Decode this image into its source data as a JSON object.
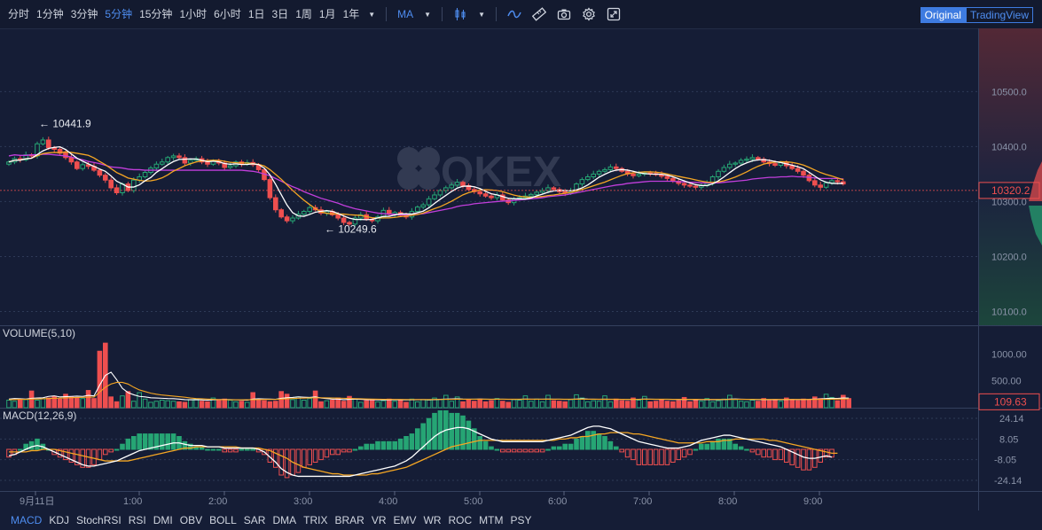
{
  "toolbar": {
    "timeframes": [
      {
        "label": "分时",
        "active": false
      },
      {
        "label": "1分钟",
        "active": false
      },
      {
        "label": "3分钟",
        "active": false
      },
      {
        "label": "5分钟",
        "active": true
      },
      {
        "label": "15分钟",
        "active": false
      },
      {
        "label": "1小时",
        "active": false
      },
      {
        "label": "6小时",
        "active": false
      },
      {
        "label": "1日",
        "active": false
      },
      {
        "label": "3日",
        "active": false
      },
      {
        "label": "1周",
        "active": false
      },
      {
        "label": "1月",
        "active": false
      },
      {
        "label": "1年",
        "active": false
      }
    ],
    "indicator_label": "MA",
    "view_original": "Original",
    "view_tradingview": "TradingView",
    "icons": [
      "candle-type-icon",
      "line-style-icon",
      "ruler-icon",
      "camera-icon",
      "gear-icon",
      "fullscreen-icon"
    ]
  },
  "watermark": "OKEX",
  "colors": {
    "up": "#26a574",
    "down": "#ee4f4f",
    "ma5": "#ffffff",
    "ma10": "#f5a623",
    "ma30": "#c13edb",
    "accent": "#4e8df0"
  },
  "chart_data": [
    {
      "type": "candlestick",
      "panel": "price",
      "y_ticks": [
        10100.0,
        10200.0,
        10300.0,
        10400.0,
        10500.0
      ],
      "ylim": [
        10075,
        10615
      ],
      "x_ticks": [
        "9月11日",
        "1:00",
        "2:00",
        "3:00",
        "4:00",
        "5:00",
        "6:00",
        "7:00",
        "8:00",
        "9:00"
      ],
      "last_price": "10320.2",
      "high_label": "10441.9",
      "low_label": "10249.6",
      "series_keys": [
        "MA5",
        "MA10",
        "MA30"
      ],
      "close": [
        10372,
        10378,
        10376,
        10385,
        10383,
        10405,
        10412,
        10398,
        10395,
        10388,
        10380,
        10372,
        10360,
        10367,
        10364,
        10357,
        10348,
        10339,
        10325,
        10316,
        10332,
        10320,
        10339,
        10345,
        10353,
        10361,
        10368,
        10372,
        10380,
        10383,
        10380,
        10370,
        10375,
        10378,
        10372,
        10368,
        10374,
        10370,
        10362,
        10365,
        10372,
        10368,
        10371,
        10367,
        10358,
        10340,
        10307,
        10285,
        10272,
        10265,
        10270,
        10277,
        10282,
        10289,
        10285,
        10279,
        10282,
        10276,
        10270,
        10262,
        10259,
        10270,
        10276,
        10268,
        10265,
        10272,
        10284,
        10277,
        10280,
        10275,
        10272,
        10282,
        10290,
        10294,
        10305,
        10312,
        10320,
        10325,
        10330,
        10335,
        10329,
        10322,
        10318,
        10314,
        10310,
        10307,
        10312,
        10303,
        10298,
        10305,
        10307,
        10310,
        10313,
        10317,
        10320,
        10325,
        10322,
        10318,
        10315,
        10319,
        10332,
        10340,
        10345,
        10350,
        10355,
        10358,
        10363,
        10360,
        10355,
        10350,
        10347,
        10350,
        10352,
        10351,
        10349,
        10346,
        10342,
        10337,
        10333,
        10330,
        10328,
        10326,
        10329,
        10333,
        10345,
        10355,
        10362,
        10368,
        10370,
        10375,
        10377,
        10380,
        10377,
        10372,
        10369,
        10366,
        10371,
        10365,
        10360,
        10355,
        10348,
        10338,
        10330,
        10326,
        10334,
        10338,
        10336,
        10332
      ],
      "ma30": [
        10383,
        10385,
        10384,
        10384,
        10385,
        10385,
        10386,
        10386,
        10385,
        10384,
        10383,
        10381,
        10378,
        10376,
        10373,
        10371,
        10369,
        10366,
        10363,
        10362,
        10361,
        10359,
        10358,
        10358,
        10357,
        10357,
        10357,
        10357,
        10357,
        10357,
        10357,
        10357,
        10357,
        10357,
        10357,
        10357,
        10357,
        10357,
        10357,
        10357,
        10357,
        10357,
        10356,
        10355,
        10353,
        10350,
        10347,
        10342,
        10337,
        10332,
        10327,
        10323,
        10318,
        10314,
        10310,
        10306,
        10303,
        10300,
        10297,
        10293,
        10290,
        10287,
        10285,
        10283,
        10281,
        10279,
        10278,
        10277,
        10277,
        10276,
        10276,
        10276,
        10277,
        10278,
        10280,
        10282,
        10284,
        10286,
        10288,
        10291,
        10293,
        10294,
        10296,
        10297,
        10298,
        10299,
        10300,
        10301,
        10301,
        10302,
        10303,
        10304,
        10305,
        10306,
        10307,
        10309,
        10310,
        10311,
        10312,
        10314,
        10316,
        10318,
        10320,
        10322,
        10324,
        10326,
        10328,
        10330,
        10331,
        10333,
        10334,
        10335,
        10336,
        10337,
        10337,
        10337,
        10337,
        10337,
        10336,
        10336,
        10335,
        10335,
        10334,
        10334,
        10334,
        10334,
        10335,
        10336,
        10337,
        10338,
        10339,
        10341,
        10342,
        10343,
        10344,
        10344,
        10345,
        10345,
        10346,
        10345,
        10345,
        10344,
        10343,
        10342,
        10342,
        10342,
        10342,
        10341
      ],
      "volume": [
        140,
        120,
        160,
        150,
        310,
        140,
        170,
        180,
        210,
        160,
        250,
        200,
        180,
        170,
        320,
        170,
        1050,
        1200,
        200,
        110,
        220,
        300,
        120,
        280,
        160,
        100,
        120,
        140,
        130,
        120,
        110,
        100,
        150,
        160,
        120,
        110,
        180,
        150,
        160,
        140,
        110,
        120,
        100,
        280,
        150,
        130,
        110,
        120,
        300,
        250,
        150,
        200,
        140,
        170,
        310,
        110,
        130,
        140,
        180,
        120,
        210,
        160,
        100,
        130,
        150,
        110,
        130,
        160,
        120,
        140,
        100,
        160,
        110,
        150,
        140,
        180,
        150,
        230,
        120,
        200,
        110,
        140,
        120,
        160,
        110,
        130,
        170,
        120,
        100,
        150,
        140,
        220,
        120,
        160,
        110,
        230,
        130,
        120,
        110,
        150,
        240,
        180,
        110,
        130,
        120,
        220,
        110,
        160,
        130,
        120,
        180,
        140,
        210,
        110,
        120,
        150,
        120,
        110,
        130,
        190,
        110,
        150,
        120,
        170,
        110,
        130,
        160,
        230,
        150,
        120,
        110,
        140,
        120,
        170,
        130,
        150,
        120,
        180,
        140,
        130,
        160,
        150,
        200,
        170,
        250,
        190,
        130,
        230,
        170
      ],
      "volume_vma5": [
        160,
        170,
        165,
        160,
        175,
        180,
        185,
        210,
        220,
        200,
        205,
        210,
        215,
        210,
        230,
        220,
        420,
        600,
        660,
        520,
        360,
        280,
        240,
        210,
        200,
        185,
        180,
        175,
        170,
        168,
        160,
        150,
        148,
        150,
        145,
        140,
        148,
        150,
        152,
        150,
        148,
        145,
        140,
        160,
        165,
        162,
        160,
        155,
        175,
        185,
        190,
        200,
        195,
        190,
        200,
        180,
        170,
        160,
        160,
        150,
        155,
        160,
        155,
        150,
        150,
        148,
        145,
        148,
        150,
        148,
        145,
        148,
        150,
        150,
        148,
        150,
        155,
        160,
        162,
        165,
        160,
        158,
        158,
        160,
        158,
        156,
        158,
        158,
        155,
        155,
        155,
        160,
        158,
        158,
        157,
        160,
        158,
        157,
        155,
        155,
        160,
        165,
        160,
        158,
        156,
        158,
        155,
        155,
        155,
        154,
        156,
        156,
        160,
        158,
        156,
        156,
        155,
        153,
        152,
        155,
        153,
        152,
        150,
        152,
        150,
        150,
        152,
        160,
        162,
        158,
        155,
        154,
        152,
        150,
        150,
        152,
        150,
        152,
        153,
        152,
        153,
        155,
        160,
        162,
        170,
        175,
        172,
        180,
        178
      ],
      "volume_vma10": [
        150,
        152,
        155,
        156,
        160,
        162,
        165,
        170,
        175,
        178,
        182,
        186,
        190,
        192,
        196,
        198,
        290,
        380,
        440,
        470,
        470,
        440,
        380,
        330,
        300,
        270,
        250,
        235,
        225,
        215,
        205,
        195,
        180,
        170,
        165,
        160,
        155,
        150,
        150,
        148,
        148,
        148,
        147,
        150,
        152,
        153,
        154,
        155,
        160,
        165,
        170,
        175,
        178,
        182,
        185,
        185,
        183,
        180,
        178,
        175,
        172,
        168,
        165,
        162,
        160,
        158,
        156,
        155,
        154,
        153,
        152,
        152,
        152,
        152,
        152,
        153,
        154,
        155,
        156,
        157,
        158,
        158,
        158,
        158,
        158,
        158,
        158,
        158,
        157,
        157,
        157,
        157,
        157,
        157,
        157,
        157,
        157,
        157,
        157,
        157,
        157,
        158,
        158,
        158,
        158,
        158,
        157,
        157,
        156,
        156,
        156,
        156,
        157,
        157,
        157,
        157,
        157,
        156,
        156,
        156,
        155,
        155,
        154,
        154,
        153,
        153,
        153,
        154,
        155,
        155,
        155,
        155,
        154,
        154,
        153,
        153,
        153,
        153,
        153,
        153,
        153,
        153,
        154,
        155,
        156,
        158,
        160,
        162,
        165
      ],
      "volume_ticks": [
        500.0,
        1000.0
      ],
      "volume_last": "109.63",
      "macd_ticks": [
        -24.14,
        -8.05,
        8.05,
        24.14
      ],
      "macd_dif": [
        -5,
        -4,
        -2,
        0,
        2,
        3,
        2,
        0,
        -2,
        -4,
        -6,
        -8,
        -10,
        -12,
        -13,
        -13,
        -12,
        -11,
        -10,
        -9,
        -7,
        -5,
        -3,
        -1,
        0,
        1,
        2,
        3,
        4,
        5,
        5,
        4,
        3,
        3,
        3,
        2,
        2,
        2,
        1,
        1,
        1,
        1,
        1,
        1,
        0,
        -2,
        -6,
        -10,
        -15,
        -18,
        -20,
        -21,
        -21,
        -21,
        -21,
        -21,
        -21,
        -21,
        -21,
        -21,
        -21,
        -20,
        -19,
        -18,
        -17,
        -16,
        -15,
        -14,
        -13,
        -11,
        -9,
        -6,
        -2,
        2,
        6,
        10,
        13,
        15,
        16,
        17,
        17,
        16,
        14,
        12,
        10,
        8,
        7,
        6,
        6,
        6,
        6,
        6,
        6,
        6,
        6,
        7,
        8,
        9,
        10,
        11,
        13,
        15,
        17,
        18,
        18,
        17,
        16,
        14,
        12,
        10,
        8,
        6,
        5,
        4,
        3,
        2,
        1,
        1,
        1,
        2,
        3,
        5,
        7,
        8,
        9,
        10,
        11,
        11,
        10,
        9,
        8,
        7,
        6,
        5,
        4,
        3,
        2,
        0,
        -2,
        -4,
        -6,
        -7,
        -7,
        -6,
        -5,
        -6
      ],
      "macd_dea": [
        -2,
        -2,
        -2,
        -2,
        -1,
        -1,
        0,
        0,
        0,
        -1,
        -2,
        -3,
        -4,
        -5,
        -6,
        -7,
        -8,
        -9,
        -9,
        -9,
        -9,
        -9,
        -8,
        -7,
        -6,
        -5,
        -4,
        -3,
        -2,
        -1,
        0,
        1,
        1,
        2,
        2,
        2,
        2,
        2,
        2,
        2,
        2,
        1,
        1,
        1,
        1,
        0,
        -1,
        -3,
        -5,
        -7,
        -10,
        -12,
        -14,
        -15,
        -16,
        -17,
        -18,
        -19,
        -19,
        -20,
        -20,
        -20,
        -20,
        -20,
        -19,
        -19,
        -18,
        -17,
        -16,
        -15,
        -14,
        -12,
        -10,
        -8,
        -6,
        -4,
        -2,
        0,
        2,
        3,
        4,
        5,
        6,
        7,
        7,
        7,
        7,
        7,
        7,
        7,
        7,
        7,
        7,
        7,
        7,
        7,
        7,
        8,
        8,
        9,
        9,
        10,
        10,
        11,
        12,
        12,
        13,
        13,
        13,
        13,
        12,
        12,
        11,
        10,
        9,
        8,
        7,
        6,
        5,
        5,
        5,
        5,
        5,
        6,
        6,
        6,
        7,
        7,
        8,
        8,
        8,
        8,
        8,
        8,
        7,
        7,
        6,
        5,
        4,
        3,
        2,
        1,
        0,
        -1,
        -2,
        -3,
        -3
      ]
    }
  ]
}
